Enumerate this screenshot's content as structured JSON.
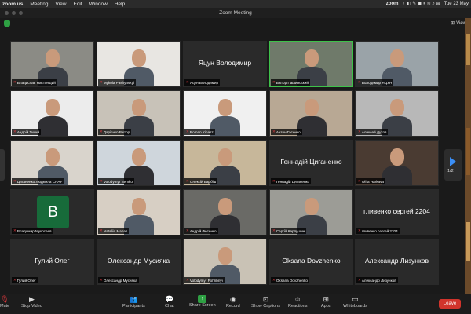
{
  "menubar": {
    "app": "zoom.us",
    "items": [
      "Meeting",
      "View",
      "Edit",
      "Window",
      "Help"
    ],
    "clock": "Tue 23 May"
  },
  "window": {
    "title": "Zoom Meeting"
  },
  "topbar": {
    "view_label": "View"
  },
  "pagination": {
    "page": "1/2"
  },
  "tiles": [
    {
      "name": "Владислав Настоящий",
      "big": "",
      "kind": "photo",
      "bg": "#8b8b85"
    },
    {
      "name": "Mykola Pashynskyi",
      "big": "",
      "kind": "photo",
      "bg": "#e8e6e2"
    },
    {
      "name": "Яцун Володимир",
      "big": "Яцун Володимир",
      "kind": "name",
      "bg": "#2a2a2a"
    },
    {
      "name": "Віктор Пашинський",
      "big": "",
      "kind": "photo",
      "bg": "#6f7a6a",
      "active": true
    },
    {
      "name": "Володимир ЯЦУН",
      "big": "",
      "kind": "photo",
      "bg": "#9aa3a8"
    },
    {
      "name": "Андрій Тихий",
      "big": "",
      "kind": "photo",
      "bg": "#ececec"
    },
    {
      "name": "Дарієнко Віктор",
      "big": "",
      "kind": "photo",
      "bg": "#c8c2b8"
    },
    {
      "name": "Roman Kinasz",
      "big": "",
      "kind": "photo",
      "bg": "#f0f0f0"
    },
    {
      "name": "Антон Гасенко",
      "big": "",
      "kind": "photo",
      "bg": "#b8a894"
    },
    {
      "name": "Алексей Дутов",
      "big": "",
      "kind": "photo",
      "bg": "#b8b8b8"
    },
    {
      "name": "Циганенко Людмила СНАУ",
      "big": "",
      "kind": "photo",
      "bg": "#d9d4cc"
    },
    {
      "name": "Volodymyr Semko",
      "big": "",
      "kind": "photo",
      "bg": "#cfd6dc"
    },
    {
      "name": "Олексій Барбіш",
      "big": "",
      "kind": "photo",
      "bg": "#c7b79a"
    },
    {
      "name": "Геннадій Циганенко",
      "big": "Геннадій Циганенко",
      "kind": "name",
      "bg": "#2a2a2a"
    },
    {
      "name": "Olha Harkava",
      "big": "",
      "kind": "photo",
      "bg": "#4a3b32"
    },
    {
      "name": "Владимир Мукосеев",
      "big": "",
      "kind": "avatar",
      "bg": "#2a2a2a",
      "letter": "В"
    },
    {
      "name": "Nataliia Mahas",
      "big": "",
      "kind": "photo",
      "bg": "#d7cfc4"
    },
    {
      "name": "Андрій Фесенко",
      "big": "",
      "kind": "photo",
      "bg": "#6a6a66"
    },
    {
      "name": "Сергій Карпушин",
      "big": "",
      "kind": "photo",
      "bg": "#9c9c96"
    },
    {
      "name": "гливенко сергей 2204",
      "big": "гливенко сергей 2204",
      "kind": "name",
      "bg": "#2a2a2a"
    },
    {
      "name": "Гулий Олег",
      "big": "Гулий Олег",
      "kind": "name",
      "bg": "#2a2a2a"
    },
    {
      "name": "Олександр Мусияка",
      "big": "Олександр Мусияка",
      "kind": "name",
      "bg": "#2a2a2a"
    },
    {
      "name": "Volodymyr Pohribnyi",
      "big": "",
      "kind": "photo",
      "bg": "#c9c2b5"
    },
    {
      "name": "Oksana Dovzhenko",
      "big": "Oksana Dovzhenko",
      "kind": "name",
      "bg": "#2a2a2a"
    },
    {
      "name": "Александр Лизунков",
      "big": "Александр Лизунков",
      "kind": "name",
      "bg": "#2a2a2a"
    }
  ],
  "toolbar": {
    "mute": "Mute",
    "stop_video": "Stop Video",
    "participants": "Participants",
    "participants_count": "40",
    "chat": "Chat",
    "share_screen": "Share Screen",
    "record": "Record",
    "show_captions": "Show Captions",
    "reactions": "Reactions",
    "apps": "Apps",
    "whiteboards": "Whiteboards",
    "leave": "Leave"
  }
}
